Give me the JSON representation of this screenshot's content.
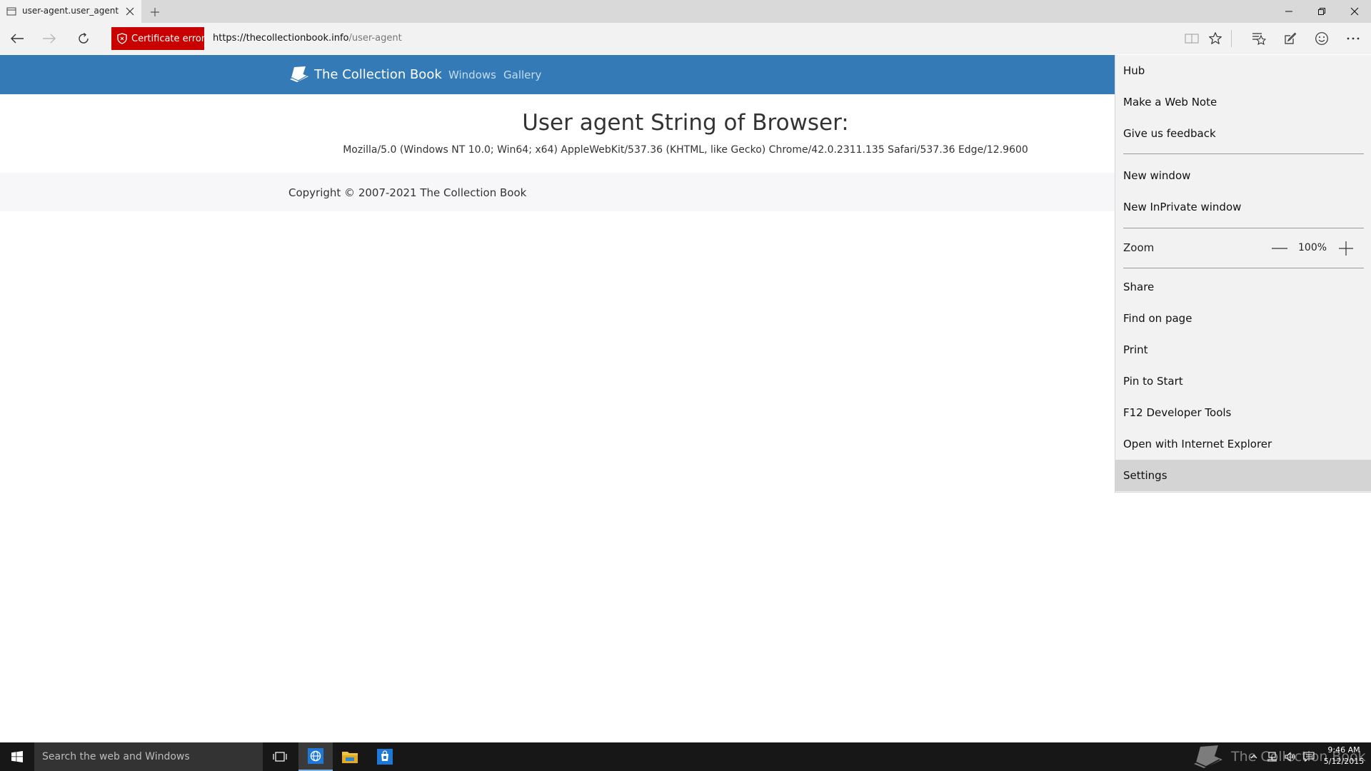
{
  "browser": {
    "tab": {
      "title": "user-agent.user_agent - The Collection Book",
      "icon": "page-icon"
    },
    "address_bar": {
      "certificate_error_label": "Certificate error",
      "url_host": "https://thecollectionbook.info",
      "url_path": "/user-agent"
    }
  },
  "site": {
    "brand": "The Collection Book",
    "nav_links": [
      "Windows",
      "Gallery"
    ],
    "heading": "User agent String of Browser:",
    "user_agent": "Mozilla/5.0 (Windows NT 10.0; Win64; x64) AppleWebKit/537.36 (KHTML, like Gecko) Chrome/42.0.2311.135 Safari/537.36 Edge/12.9600",
    "copyright": "Copyright © 2007-2021 The Collection Book"
  },
  "menu": {
    "group1": [
      "Hub",
      "Make a Web Note",
      "Give us feedback"
    ],
    "group2": [
      "New window",
      "New InPrivate window"
    ],
    "zoom": {
      "label": "Zoom",
      "value": "100%"
    },
    "group3": [
      "Share",
      "Find on page",
      "Print",
      "Pin to Start",
      "F12 Developer Tools",
      "Open with Internet Explorer",
      "Settings"
    ],
    "highlighted_item": "Settings"
  },
  "taskbar": {
    "search_placeholder": "Search the web and Windows",
    "watermark": "The Collection Book",
    "time": "9:46 AM",
    "date": "5/12/2015"
  },
  "colors": {
    "nav_blue": "#337ab7",
    "certificate_error_red": "#c80000",
    "taskbar": "#171717",
    "menu_background": "#f2f2f2",
    "menu_highlight": "#d4d4d4"
  }
}
